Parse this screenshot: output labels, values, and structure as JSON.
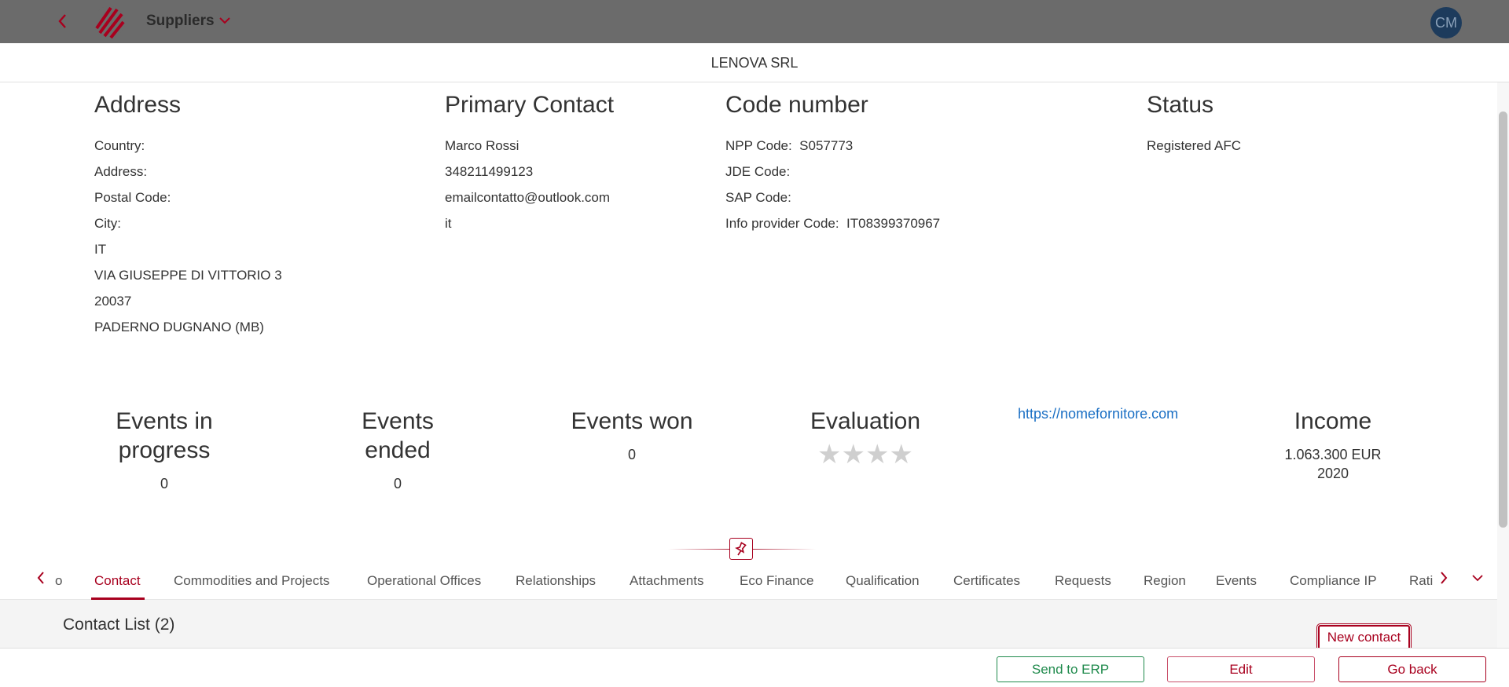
{
  "header": {
    "title": "Suppliers",
    "avatar_initials": "CM"
  },
  "company": {
    "name": "LENOVA SRL"
  },
  "address": {
    "heading": "Address",
    "lines": [
      "Country:",
      "Address:",
      "Postal Code:",
      "City:",
      "IT",
      "VIA GIUSEPPE DI VITTORIO 3",
      "20037",
      "PADERNO DUGNANO (MB)"
    ]
  },
  "primary_contact": {
    "heading": "Primary Contact",
    "lines": [
      "Marco Rossi",
      "348211499123",
      "emailcontatto@outlook.com",
      "it"
    ]
  },
  "code_number": {
    "heading": "Code number",
    "lines": [
      "NPP Code:  S057773",
      "JDE Code:",
      "SAP Code:",
      "Info provider Code:  IT08399370967"
    ]
  },
  "status": {
    "heading": "Status",
    "value": "Registered AFC"
  },
  "kpis": {
    "events_in_progress": {
      "title_line1": "Events in",
      "title_line2": "progress",
      "value": "0"
    },
    "events_ended": {
      "title_line1": "Events",
      "title_line2": "ended",
      "value": "0"
    },
    "events_won": {
      "title": "Events won",
      "value": "0"
    },
    "evaluation": {
      "title": "Evaluation",
      "stars": "★★★★",
      "rating": 0
    },
    "website": "https://nomefornitore.com",
    "income": {
      "title": "Income",
      "amount": "1.063.300 EUR",
      "year": "2020"
    }
  },
  "tabs": {
    "partial_left": "o",
    "items": [
      "Contact",
      "Commodities and Projects",
      "Operational Offices",
      "Relationships",
      "Attachments",
      "Eco Finance",
      "Qualification",
      "Certificates",
      "Requests",
      "Region",
      "Events",
      "Compliance IP",
      "Rati"
    ],
    "active": "Contact"
  },
  "contact_list": {
    "title": "Contact List (2)",
    "new_button": "New contact"
  },
  "footer": {
    "send_erp": "Send to ERP",
    "edit": "Edit",
    "go_back": "Go back"
  },
  "colors": {
    "accent": "#a8001e",
    "topbar": "#6b6b6b",
    "avatar_bg": "#1d3b5c",
    "link": "#1a6fc4",
    "send_erp": "#1f8a4c"
  },
  "icons": {
    "back": "chevron-left-icon",
    "logo": "logo-icon",
    "title_dropdown": "chevron-down-icon",
    "pin": "pin-icon",
    "tabs_prev": "chevron-left-icon",
    "tabs_next": "chevron-right-icon",
    "tabs_more": "chevron-down-icon"
  }
}
